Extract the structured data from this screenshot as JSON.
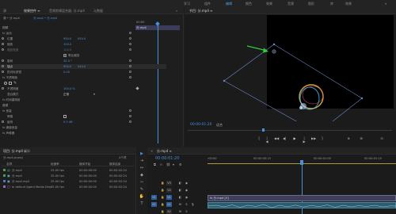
{
  "top_menu": {
    "items": [
      "学习",
      "组件",
      "编辑",
      "颜色",
      "效果",
      "音频",
      "图形",
      "库",
      "效果"
    ],
    "active_index": 2
  },
  "effect_controls": {
    "tabs": [
      "效果控件 ≡",
      "音频剪辑混合器: 分.mp4",
      "元数据"
    ],
    "breadcrumb_source": "源 • 分.mp4",
    "breadcrumb_seq": "分.mp4 • 分.mp4",
    "mini_timecode": "00:00",
    "clip_label": "分.mp4",
    "sections": {
      "video_header": "视频",
      "motion": "fx 运动",
      "position_label": "位置",
      "position_x": "950.0",
      "position_y": "950.0",
      "scale_label": "缩放",
      "scale_val": "100.0",
      "scale_width_label": "缩放宽度",
      "scale_width_val": "100.0",
      "uniform_scale_label": "等比缩放",
      "rotation_label": "旋转",
      "rotation_val": "35.0 °",
      "anchor_label": "锚点",
      "anchor_x": "950.0",
      "anchor_y": "540.0",
      "antiflicker_label": "防闪烁滤镜",
      "antiflicker_val": "0.00",
      "opacity_header": "fx 不透明度",
      "opacity_label": "不透明度",
      "opacity_val": "100.0 %",
      "blend_label": "混合模式",
      "blend_val": "正常",
      "time_remap": "fx 时间重映射",
      "audio_header": "音频",
      "volume_header": "fx 音量",
      "bypass_label": "旁路",
      "level_label": "级别",
      "level_val": "0.0 dB",
      "channel_volume": "fx 通道音量",
      "panner": "fx 声像器"
    }
  },
  "program_monitor": {
    "title": "节目: 分.mp4 ≡",
    "timecode": "00:00:01:20",
    "fit": "适合",
    "playback_buttons": [
      "{",
      "|◀",
      "◀◀",
      "◀|",
      "▶",
      "|▶",
      "▶▶",
      "}",
      "⊕",
      "⊞",
      "⊡"
    ]
  },
  "project_panel": {
    "tabs": [
      "项目: 分.mp4 ≡",
      "媒体"
    ],
    "path": "分.mp4.prproj",
    "item_count": "4个项",
    "columns": [
      "名称",
      "帧速率",
      "媒体开始",
      "媒体结束"
    ],
    "rows": [
      {
        "name": "分.mp4",
        "fps": "25.00 fps",
        "start": "00:00:00:00",
        "end": "00:00:02:24"
      },
      {
        "name": "分.mp4",
        "fps": "25.00 fps",
        "start": "00:00:00:00",
        "end": "00:00:02:24"
      },
      {
        "name": "分.mp4.mp4",
        "fps": "25.00 fps",
        "start": "00:00:00:00",
        "end": "00:00:02:24"
      },
      {
        "name": "In default Agent Media Dmp",
        "fps": "25.00 fps",
        "start": "00:00:00:00",
        "end": "00:00:02:24"
      }
    ]
  },
  "timeline": {
    "tab": "分.mp4 ≡",
    "timecode": "00:00:01:20",
    "ruler_labels": [
      ":00:00",
      "00:00:00:15",
      "00:00:01:00",
      "00:00:01:15"
    ],
    "tracks": [
      "V3",
      "V2",
      "V1",
      "A1",
      "A2"
    ],
    "clip_label": "fx 分.mp4 [V]"
  },
  "tools": [
    "▶",
    "⇥",
    "↔",
    "◆",
    "⇿",
    "✎",
    "✋",
    "T"
  ],
  "colors": {
    "accent": "#4a8fd9",
    "clip_fill": "#3e3e5a",
    "audio_clip": "#2b5d6f",
    "arrow": "#2ecc40",
    "playhead": "#4a8fd9"
  }
}
